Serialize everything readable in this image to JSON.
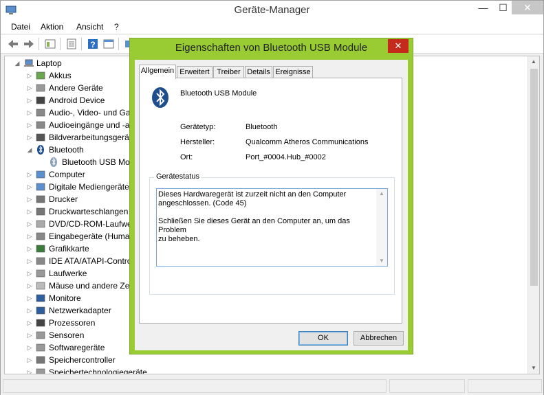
{
  "window": {
    "title": "Geräte-Manager",
    "minimize": "—",
    "maximize": "☐",
    "close": "✕"
  },
  "menu": [
    "Datei",
    "Aktion",
    "Ansicht",
    "?"
  ],
  "tree": {
    "root": "Laptop",
    "items": [
      {
        "label": "Akkus",
        "icon": "battery-icon",
        "expander": "▷"
      },
      {
        "label": "Andere Geräte",
        "icon": "unknown-device-icon",
        "expander": "▷"
      },
      {
        "label": "Android Device",
        "icon": "android-device-icon",
        "expander": "▷"
      },
      {
        "label": "Audio-, Video- und Ga",
        "icon": "speaker-icon",
        "expander": "▷"
      },
      {
        "label": "Audioeingänge und -a",
        "icon": "speaker-icon",
        "expander": "▷"
      },
      {
        "label": "Bildverarbeitungsgerät",
        "icon": "camera-icon",
        "expander": "▷"
      },
      {
        "label": "Bluetooth",
        "icon": "bluetooth-icon",
        "expander": "◢"
      },
      {
        "label": "Bluetooth USB Mo",
        "icon": "bluetooth-icon",
        "expander": ""
      },
      {
        "label": "Computer",
        "icon": "computer-icon",
        "expander": "▷"
      },
      {
        "label": "Digitale Mediengeräte",
        "icon": "media-device-icon",
        "expander": "▷"
      },
      {
        "label": "Drucker",
        "icon": "printer-icon",
        "expander": "▷"
      },
      {
        "label": "Druckwarteschlangen",
        "icon": "print-queue-icon",
        "expander": "▷"
      },
      {
        "label": "DVD/CD-ROM-Laufwe",
        "icon": "disc-drive-icon",
        "expander": "▷"
      },
      {
        "label": "Eingabegeräte (Human",
        "icon": "hid-icon",
        "expander": "▷"
      },
      {
        "label": "Grafikkarte",
        "icon": "display-adapter-icon",
        "expander": "▷"
      },
      {
        "label": "IDE ATA/ATAPI-Contro",
        "icon": "ide-controller-icon",
        "expander": "▷"
      },
      {
        "label": "Laufwerke",
        "icon": "drive-icon",
        "expander": "▷"
      },
      {
        "label": "Mäuse und andere Zei",
        "icon": "mouse-icon",
        "expander": "▷"
      },
      {
        "label": "Monitore",
        "icon": "monitor-icon",
        "expander": "▷"
      },
      {
        "label": "Netzwerkadapter",
        "icon": "network-adapter-icon",
        "expander": "▷"
      },
      {
        "label": "Prozessoren",
        "icon": "processor-icon",
        "expander": "▷"
      },
      {
        "label": "Sensoren",
        "icon": "sensor-icon",
        "expander": "▷"
      },
      {
        "label": "Softwaregeräte",
        "icon": "software-device-icon",
        "expander": "▷"
      },
      {
        "label": "Speichercontroller",
        "icon": "storage-controller-icon",
        "expander": "▷"
      },
      {
        "label": "Speichertechnologiegeräte",
        "icon": "memory-technology-icon",
        "expander": "▷"
      }
    ]
  },
  "dialog": {
    "title": "Eigenschaften von Bluetooth USB Module",
    "close": "✕",
    "tabs": [
      "Allgemein",
      "Erweitert",
      "Treiber",
      "Details",
      "Ereignisse"
    ],
    "active_tab": "Allgemein",
    "device_name": "Bluetooth USB Module",
    "properties": [
      {
        "label": "Gerätetyp:",
        "value": "Bluetooth"
      },
      {
        "label": "Hersteller:",
        "value": "Qualcomm Atheros Communications"
      },
      {
        "label": "Ort:",
        "value": "Port_#0004.Hub_#0002"
      }
    ],
    "status_group_title": "Gerätestatus",
    "status_line1": "Dieses Hardwaregerät ist zurzeit nicht an den Computer",
    "status_line2": "angeschlossen. (Code 45)",
    "status_line3": "Schließen Sie dieses Gerät an den Computer an, um das Problem",
    "status_line4": "zu beheben.",
    "ok_label": "OK",
    "cancel_label": "Abbrechen"
  },
  "colors": {
    "dialog_frame": "#99cc33",
    "dialog_close": "#c42b1c",
    "accent_border": "#7aa7d9"
  }
}
